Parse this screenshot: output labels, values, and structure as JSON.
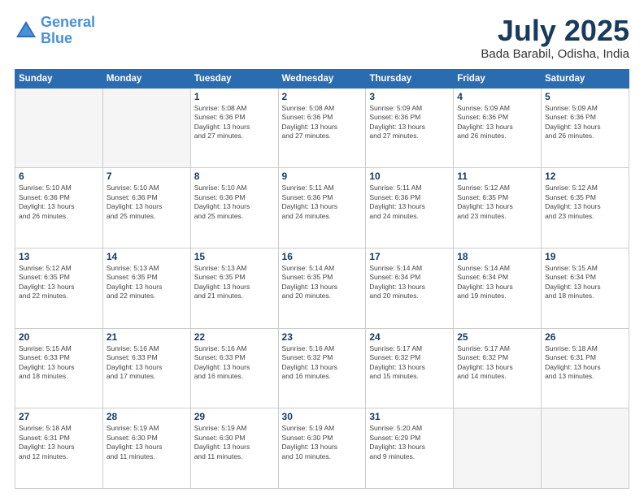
{
  "header": {
    "logo_line1": "General",
    "logo_line2": "Blue",
    "title": "July 2025",
    "location": "Bada Barabil, Odisha, India"
  },
  "weekdays": [
    "Sunday",
    "Monday",
    "Tuesday",
    "Wednesday",
    "Thursday",
    "Friday",
    "Saturday"
  ],
  "weeks": [
    [
      {
        "day": "",
        "info": ""
      },
      {
        "day": "",
        "info": ""
      },
      {
        "day": "1",
        "info": "Sunrise: 5:08 AM\nSunset: 6:36 PM\nDaylight: 13 hours\nand 27 minutes."
      },
      {
        "day": "2",
        "info": "Sunrise: 5:08 AM\nSunset: 6:36 PM\nDaylight: 13 hours\nand 27 minutes."
      },
      {
        "day": "3",
        "info": "Sunrise: 5:09 AM\nSunset: 6:36 PM\nDaylight: 13 hours\nand 27 minutes."
      },
      {
        "day": "4",
        "info": "Sunrise: 5:09 AM\nSunset: 6:36 PM\nDaylight: 13 hours\nand 26 minutes."
      },
      {
        "day": "5",
        "info": "Sunrise: 5:09 AM\nSunset: 6:36 PM\nDaylight: 13 hours\nand 26 minutes."
      }
    ],
    [
      {
        "day": "6",
        "info": "Sunrise: 5:10 AM\nSunset: 6:36 PM\nDaylight: 13 hours\nand 26 minutes."
      },
      {
        "day": "7",
        "info": "Sunrise: 5:10 AM\nSunset: 6:36 PM\nDaylight: 13 hours\nand 25 minutes."
      },
      {
        "day": "8",
        "info": "Sunrise: 5:10 AM\nSunset: 6:36 PM\nDaylight: 13 hours\nand 25 minutes."
      },
      {
        "day": "9",
        "info": "Sunrise: 5:11 AM\nSunset: 6:36 PM\nDaylight: 13 hours\nand 24 minutes."
      },
      {
        "day": "10",
        "info": "Sunrise: 5:11 AM\nSunset: 6:36 PM\nDaylight: 13 hours\nand 24 minutes."
      },
      {
        "day": "11",
        "info": "Sunrise: 5:12 AM\nSunset: 6:35 PM\nDaylight: 13 hours\nand 23 minutes."
      },
      {
        "day": "12",
        "info": "Sunrise: 5:12 AM\nSunset: 6:35 PM\nDaylight: 13 hours\nand 23 minutes."
      }
    ],
    [
      {
        "day": "13",
        "info": "Sunrise: 5:12 AM\nSunset: 6:35 PM\nDaylight: 13 hours\nand 22 minutes."
      },
      {
        "day": "14",
        "info": "Sunrise: 5:13 AM\nSunset: 6:35 PM\nDaylight: 13 hours\nand 22 minutes."
      },
      {
        "day": "15",
        "info": "Sunrise: 5:13 AM\nSunset: 6:35 PM\nDaylight: 13 hours\nand 21 minutes."
      },
      {
        "day": "16",
        "info": "Sunrise: 5:14 AM\nSunset: 6:35 PM\nDaylight: 13 hours\nand 20 minutes."
      },
      {
        "day": "17",
        "info": "Sunrise: 5:14 AM\nSunset: 6:34 PM\nDaylight: 13 hours\nand 20 minutes."
      },
      {
        "day": "18",
        "info": "Sunrise: 5:14 AM\nSunset: 6:34 PM\nDaylight: 13 hours\nand 19 minutes."
      },
      {
        "day": "19",
        "info": "Sunrise: 5:15 AM\nSunset: 6:34 PM\nDaylight: 13 hours\nand 18 minutes."
      }
    ],
    [
      {
        "day": "20",
        "info": "Sunrise: 5:15 AM\nSunset: 6:33 PM\nDaylight: 13 hours\nand 18 minutes."
      },
      {
        "day": "21",
        "info": "Sunrise: 5:16 AM\nSunset: 6:33 PM\nDaylight: 13 hours\nand 17 minutes."
      },
      {
        "day": "22",
        "info": "Sunrise: 5:16 AM\nSunset: 6:33 PM\nDaylight: 13 hours\nand 16 minutes."
      },
      {
        "day": "23",
        "info": "Sunrise: 5:16 AM\nSunset: 6:32 PM\nDaylight: 13 hours\nand 16 minutes."
      },
      {
        "day": "24",
        "info": "Sunrise: 5:17 AM\nSunset: 6:32 PM\nDaylight: 13 hours\nand 15 minutes."
      },
      {
        "day": "25",
        "info": "Sunrise: 5:17 AM\nSunset: 6:32 PM\nDaylight: 13 hours\nand 14 minutes."
      },
      {
        "day": "26",
        "info": "Sunrise: 5:18 AM\nSunset: 6:31 PM\nDaylight: 13 hours\nand 13 minutes."
      }
    ],
    [
      {
        "day": "27",
        "info": "Sunrise: 5:18 AM\nSunset: 6:31 PM\nDaylight: 13 hours\nand 12 minutes."
      },
      {
        "day": "28",
        "info": "Sunrise: 5:19 AM\nSunset: 6:30 PM\nDaylight: 13 hours\nand 11 minutes."
      },
      {
        "day": "29",
        "info": "Sunrise: 5:19 AM\nSunset: 6:30 PM\nDaylight: 13 hours\nand 11 minutes."
      },
      {
        "day": "30",
        "info": "Sunrise: 5:19 AM\nSunset: 6:30 PM\nDaylight: 13 hours\nand 10 minutes."
      },
      {
        "day": "31",
        "info": "Sunrise: 5:20 AM\nSunset: 6:29 PM\nDaylight: 13 hours\nand 9 minutes."
      },
      {
        "day": "",
        "info": ""
      },
      {
        "day": "",
        "info": ""
      }
    ]
  ]
}
